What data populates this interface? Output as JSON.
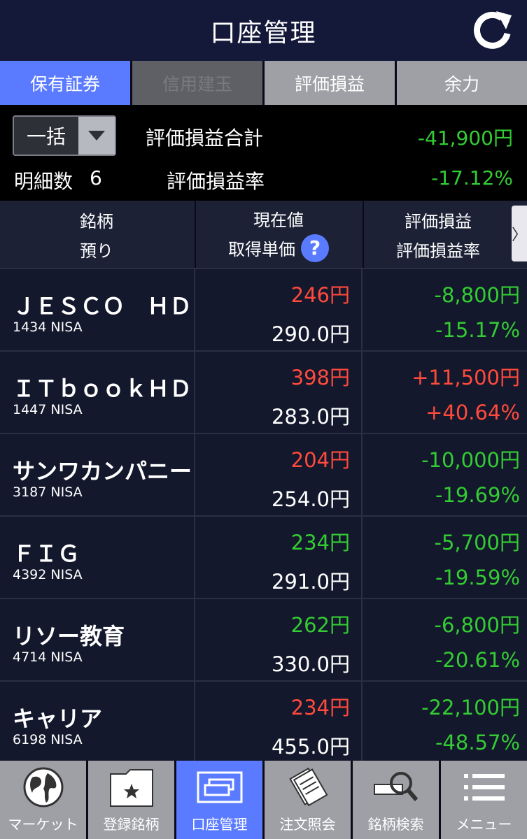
{
  "header": {
    "title": "口座管理",
    "refresh_icon": "refresh-icon"
  },
  "tabs": [
    {
      "label": "保有証券",
      "state": "active"
    },
    {
      "label": "信用建玉",
      "state": "disabled"
    },
    {
      "label": "評価損益",
      "state": "normal"
    },
    {
      "label": "余力",
      "state": "normal"
    }
  ],
  "summary": {
    "dropdown_value": "一括",
    "total_pl_label": "評価損益合計",
    "total_pl_value": "-41,900円",
    "count_label": "明細数",
    "count_value": "6",
    "pl_rate_label": "評価損益率",
    "pl_rate_value": "-17.12%"
  },
  "columns": {
    "c1_row1": "銘柄",
    "c1_row2": "預り",
    "c2_row1": "現在値",
    "c2_row2": "取得単価",
    "c3_row1": "評価損益",
    "c3_row2": "評価損益率",
    "help_icon": "?"
  },
  "holdings": [
    {
      "name": "ＪＥＳＣＯ　ＨＤ",
      "code": "1434 NISA",
      "price": "246円",
      "cost": "290.0円",
      "pl": "-8,800円",
      "pl_rate": "-15.17%"
    },
    {
      "name": "ＩＴｂｏｏｋＨＤ",
      "code": "1447 NISA",
      "price": "398円",
      "cost": "283.0円",
      "pl": "+11,500円",
      "pl_rate": "+40.64%"
    },
    {
      "name": "サンワカンパニー",
      "code": "3187 NISA",
      "price": "204円",
      "cost": "254.0円",
      "pl": "-10,000円",
      "pl_rate": "-19.69%"
    },
    {
      "name": "ＦＩＧ",
      "code": "4392 NISA",
      "price": "234円",
      "cost": "291.0円",
      "pl": "-5,700円",
      "pl_rate": "-19.59%"
    },
    {
      "name": "リソー教育",
      "code": "4714 NISA",
      "price": "262円",
      "cost": "330.0円",
      "pl": "-6,800円",
      "pl_rate": "-20.61%"
    },
    {
      "name": "キャリア",
      "code": "6198 NISA",
      "price": "234円",
      "cost": "455.0円",
      "pl": "-22,100円",
      "pl_rate": "-48.57%"
    }
  ],
  "row_colors": {
    "price": [
      "red",
      "red",
      "red",
      "green",
      "green",
      "red"
    ],
    "pl": [
      "green",
      "red",
      "green",
      "green",
      "green",
      "green"
    ]
  },
  "nav": [
    {
      "label": "マーケット",
      "icon": "globe-icon"
    },
    {
      "label": "登録銘柄",
      "icon": "star-folder-icon"
    },
    {
      "label": "口座管理",
      "icon": "account-cards-icon",
      "active": true
    },
    {
      "label": "注文照会",
      "icon": "documents-icon"
    },
    {
      "label": "銘柄検索",
      "icon": "magnifier-icon"
    },
    {
      "label": "メニュー",
      "icon": "menu-icon"
    }
  ],
  "colors": {
    "accent": "#5a7bff",
    "up": "#ff4a3d",
    "down": "#33cc33",
    "header_bg": "#14193a"
  }
}
